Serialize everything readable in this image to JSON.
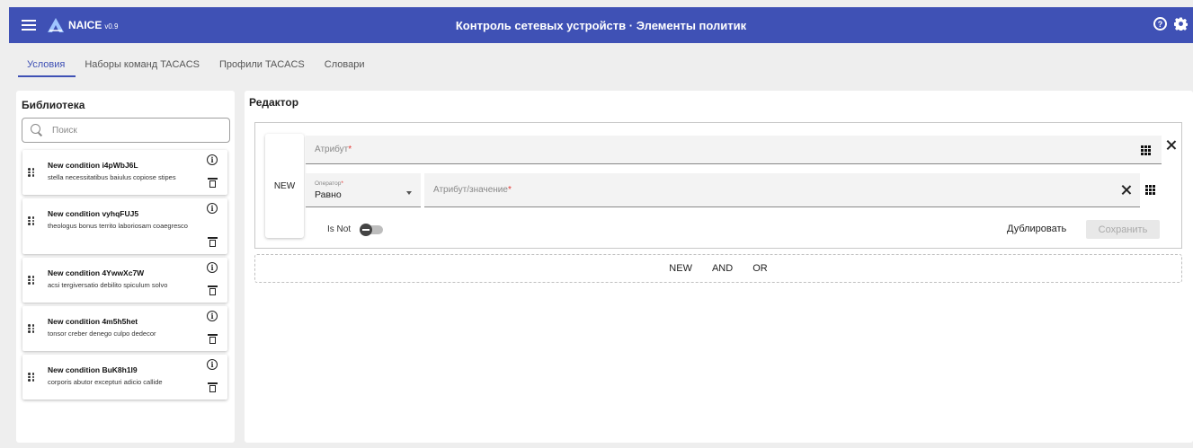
{
  "app": {
    "name": "NAICE",
    "version": "v0.9",
    "title": "Контроль сетевых устройств · Элементы политик",
    "help_glyph": "?"
  },
  "tabs": [
    {
      "label": "Условия",
      "active": true
    },
    {
      "label": "Наборы команд TACACS",
      "active": false
    },
    {
      "label": "Профили TACACS",
      "active": false
    },
    {
      "label": "Словари",
      "active": false
    }
  ],
  "library": {
    "title": "Библиотека",
    "search_placeholder": "Поиск",
    "items": [
      {
        "title": "New condition i4pWbJ6L",
        "desc": "stella necessitatibus baiulus copiose stipes"
      },
      {
        "title": "New condition vyhqFUJ5",
        "desc": "theologus bonus territo laboriosam coaegresco"
      },
      {
        "title": "New condition 4YwwXc7W",
        "desc": "acsi tergiversatio debilito spiculum solvo"
      },
      {
        "title": "New condition 4m5h5het",
        "desc": "tonsor creber denego culpo dedecor"
      },
      {
        "title": "New condition BuK8h1I9",
        "desc": "corporis abutor excepturi adicio callide"
      }
    ],
    "info_glyph": "i"
  },
  "editor": {
    "title": "Редактор",
    "new_tag": "NEW",
    "attribute_label": "Атрибут",
    "required_mark": "*",
    "operator_label": "Оператор",
    "operator_value": "Равно",
    "value_label": "Атрибут/значение",
    "is_not_label": "Is Not",
    "is_not_enabled": false,
    "duplicate_label": "Дублировать",
    "save_label": "Сохранить",
    "add_buttons": [
      "NEW",
      "AND",
      "OR"
    ]
  },
  "colors": {
    "primary": "#3f51b5",
    "required": "#e53935"
  }
}
